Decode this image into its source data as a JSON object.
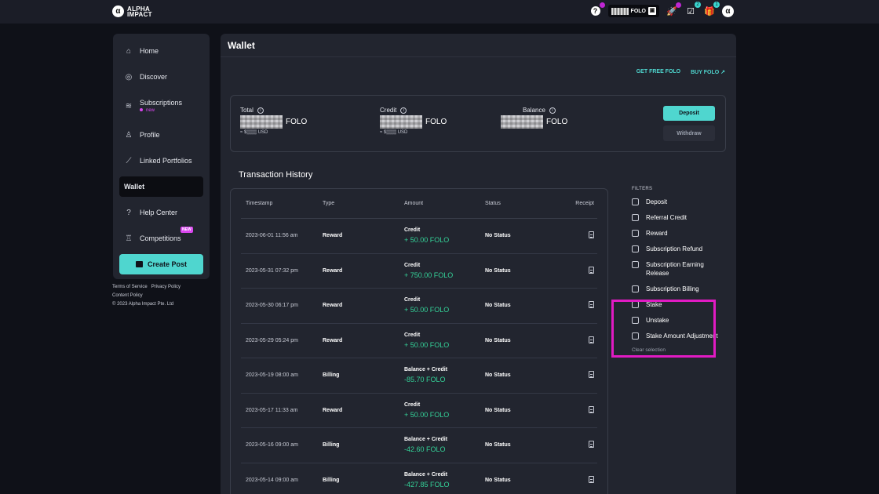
{
  "brand": {
    "logo_text": "ALPHA IMPACT"
  },
  "topbar": {
    "folo_label": "FOLO",
    "badges": {
      "tasks": "2",
      "gifts": "1"
    }
  },
  "sidebar": {
    "items": [
      {
        "label": "Home",
        "icon": "home-icon"
      },
      {
        "label": "Discover",
        "icon": "globe-icon"
      },
      {
        "label": "Subscriptions",
        "icon": "wifi-icon",
        "sub": "new"
      },
      {
        "label": "Profile",
        "icon": "user-icon"
      },
      {
        "label": "Linked Portfolios",
        "icon": "chart-line-icon"
      },
      {
        "label": "Wallet",
        "icon": "wallet-icon"
      },
      {
        "label": "Help Center",
        "icon": "help-icon"
      },
      {
        "label": "Competitions",
        "icon": "trophy-icon",
        "tag": "NEW"
      }
    ],
    "create_post": "Create Post"
  },
  "footer": {
    "terms": "Terms of Service",
    "privacy": "Privacy Policy",
    "content": "Content Policy",
    "copyright": "© 2023 Alpha Impact Pte. Ltd"
  },
  "wallet": {
    "title": "Wallet",
    "get_free": "GET FREE FOLO",
    "buy": "BUY FOLO",
    "summary": {
      "total_label": "Total",
      "credit_label": "Credit",
      "balance_label": "Balance",
      "unit": "FOLO",
      "usd_prefix": "≈ $",
      "usd_suffix": "USD"
    },
    "deposit": "Deposit",
    "withdraw": "Withdraw"
  },
  "transactions": {
    "title": "Transaction History",
    "columns": [
      "Timestamp",
      "Type",
      "Amount",
      "Status",
      "Receipt"
    ],
    "rows": [
      {
        "ts": "2023-06-01 11:56 am",
        "type": "Reward",
        "amt_label": "Credit",
        "amt": "+ 50.00 FOLO",
        "status": "No Status"
      },
      {
        "ts": "2023-05-31 07:32 pm",
        "type": "Reward",
        "amt_label": "Credit",
        "amt": "+ 750.00 FOLO",
        "status": "No Status"
      },
      {
        "ts": "2023-05-30 06:17 pm",
        "type": "Reward",
        "amt_label": "Credit",
        "amt": "+ 50.00 FOLO",
        "status": "No Status"
      },
      {
        "ts": "2023-05-29 05:24 pm",
        "type": "Reward",
        "amt_label": "Credit",
        "amt": "+ 50.00 FOLO",
        "status": "No Status"
      },
      {
        "ts": "2023-05-19 08:00 am",
        "type": "Billing",
        "amt_label": "Balance + Credit",
        "amt": "-85.70 FOLO",
        "status": "No Status"
      },
      {
        "ts": "2023-05-17 11:33 am",
        "type": "Reward",
        "amt_label": "Credit",
        "amt": "+ 50.00 FOLO",
        "status": "No Status"
      },
      {
        "ts": "2023-05-16 09:00 am",
        "type": "Billing",
        "amt_label": "Balance + Credit",
        "amt": "-42.60 FOLO",
        "status": "No Status"
      },
      {
        "ts": "2023-05-14 09:00 am",
        "type": "Billing",
        "amt_label": "Balance + Credit",
        "amt": "-427.85 FOLO",
        "status": "No Status"
      }
    ]
  },
  "filters": {
    "title": "FILTERS",
    "options": [
      "Deposit",
      "Referral Credit",
      "Reward",
      "Subscription Refund",
      "Subscription Earning Release",
      "Subscription Billing",
      "Stake",
      "Unstake",
      "Stake Amount Adjustment"
    ],
    "clear": "Clear selection"
  },
  "colors": {
    "accent": "#4fd6cf",
    "highlight": "#e11bc3",
    "positive": "#34d399"
  }
}
